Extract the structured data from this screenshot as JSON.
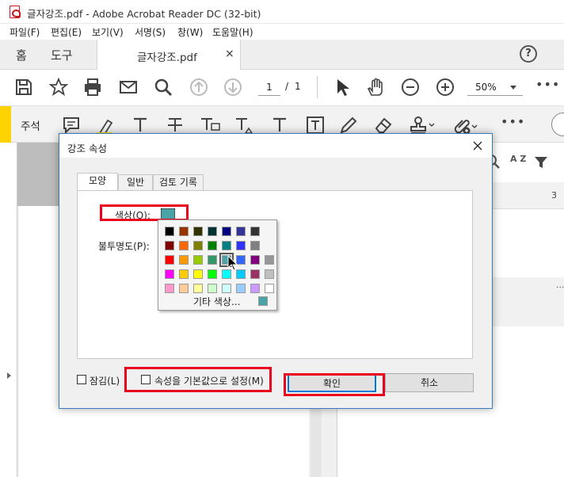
{
  "window": {
    "title": "글자강조.pdf - Adobe Acrobat Reader DC (32-bit)"
  },
  "menu": [
    "파일(F)",
    "편집(E)",
    "보기(V)",
    "서명(S)",
    "창(W)",
    "도움말(H)"
  ],
  "tabs": {
    "home": "홈",
    "tools": "도구",
    "document": "글자강조.pdf",
    "close_glyph": "×",
    "help_glyph": "?"
  },
  "toolbar": {
    "page_current": "1",
    "page_separator": "/",
    "page_total": "1",
    "zoom": "50%",
    "more": "•••"
  },
  "comment_bar": {
    "label": "주석",
    "more": "•••"
  },
  "right_pane": {
    "count": "3",
    "more": "···",
    "sort_icon_text": "A Z"
  },
  "dialog": {
    "title": "강조 속성",
    "tabs": [
      "모양",
      "일반",
      "검토 기록"
    ],
    "color_label": "색상(O):",
    "opacity_label": "불투명도(P):",
    "selected_color": "#4aa3a6",
    "more_colors_label": "기타 색상...",
    "lock_label": "잠김(L)",
    "default_label": "속성을 기본값으로 설정(M)",
    "ok_label": "확인",
    "cancel_label": "취소",
    "palette": [
      [
        "#000000",
        "#993300",
        "#333300",
        "#003333",
        "#000080",
        "#333399",
        "#333333"
      ],
      [
        "#800000",
        "#ff6600",
        "#808000",
        "#008000",
        "#008080",
        "#3333ff",
        "#808080"
      ],
      [
        "#ff0000",
        "#ff9900",
        "#99cc00",
        "#339966",
        "#4aa3a6",
        "#3366ff",
        "#800080",
        "#969696"
      ],
      [
        "#ff00ff",
        "#ffcc00",
        "#ffff00",
        "#00ff00",
        "#00ffff",
        "#00ccff",
        "#993366",
        "#c0c0c0"
      ],
      [
        "#ff99cc",
        "#ffcc99",
        "#ffff99",
        "#ccffcc",
        "#ccffff",
        "#99ccff",
        "#cc99ff",
        "#ffffff"
      ]
    ]
  },
  "colors": {
    "highlight_red": "#e8001c",
    "accent_yellow": "#ffd200",
    "dialog_border": "#3a78c2"
  }
}
